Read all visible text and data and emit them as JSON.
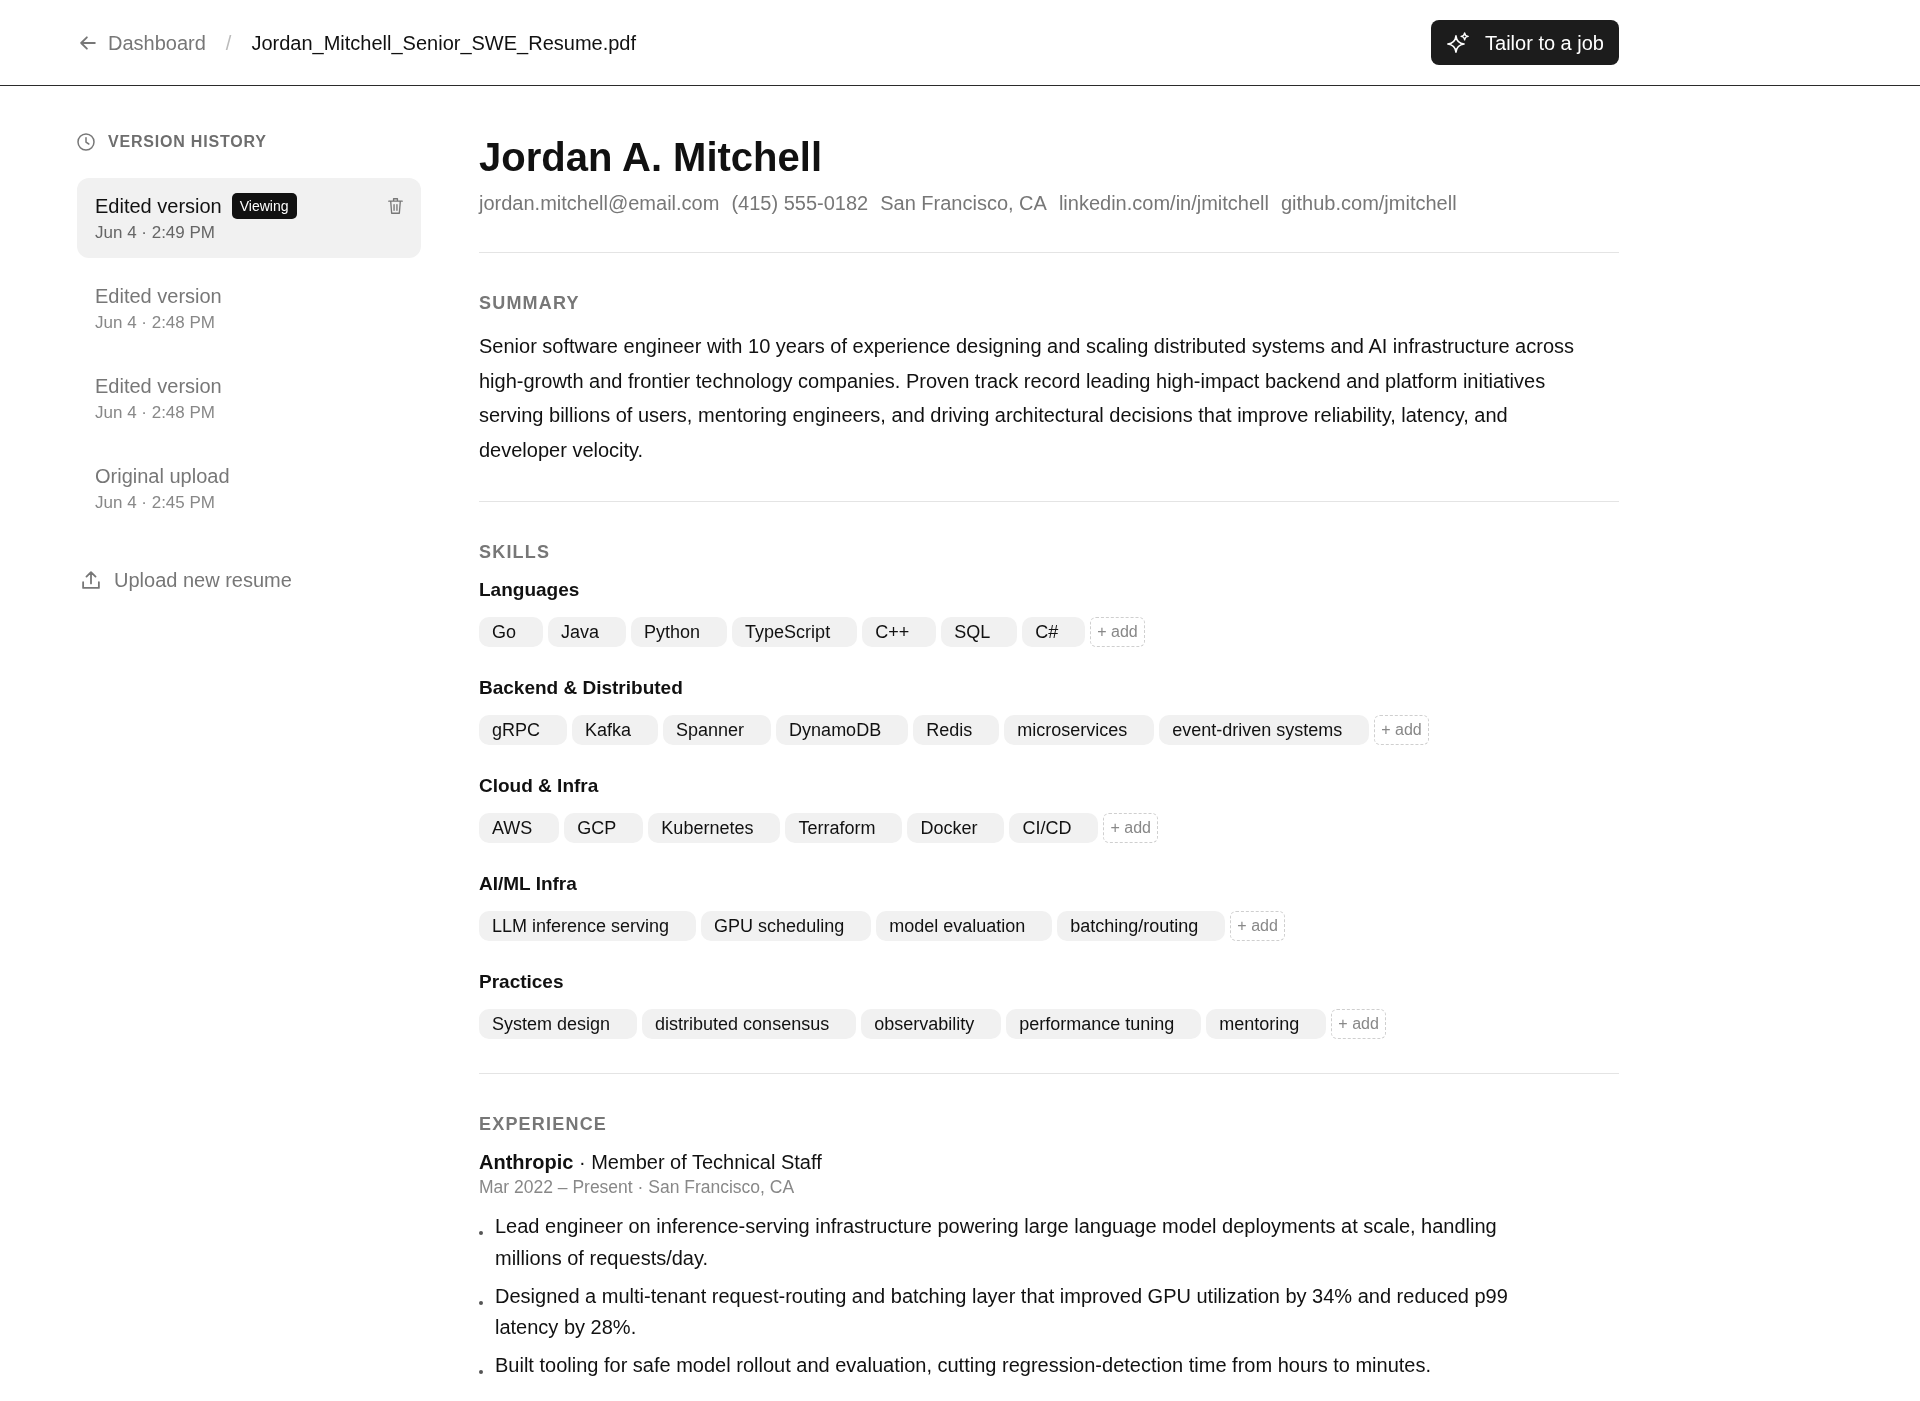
{
  "header": {
    "back_link": "Dashboard",
    "separator": "/",
    "file_name": "Jordan_Mitchell_Senior_SWE_Resume.pdf",
    "action_button": "Tailor to a job"
  },
  "version_history": {
    "title": "VERSION HISTORY",
    "versions": [
      {
        "label": "Edited version",
        "badge": "Viewing",
        "time": "Jun 4 · 2:49 PM",
        "selected": true
      },
      {
        "label": "Edited version",
        "time": "Jun 4 · 2:48 PM",
        "selected": false
      },
      {
        "label": "Edited version",
        "time": "Jun 4 · 2:48 PM",
        "selected": false
      },
      {
        "label": "Original upload",
        "time": "Jun 4 · 2:45 PM",
        "selected": false
      }
    ],
    "upload_link": "Upload new resume"
  },
  "resume": {
    "name": "Jordan A. Mitchell",
    "contact": [
      "jordan.mitchell@email.com",
      "(415) 555-0182",
      "San Francisco, CA",
      "linkedin.com/in/jmitchell",
      "github.com/jmitchell"
    ],
    "sections": [
      {
        "kind": "text",
        "title": "SUMMARY",
        "text": "Senior software engineer with 10 years of experience designing and scaling distributed systems and AI infrastructure across high-growth and frontier technology companies. Proven track record leading high-impact backend and platform initiatives serving billions of users, mentoring engineers, and driving architectural decisions that improve reliability, latency, and developer velocity."
      },
      {
        "kind": "skills",
        "title": "SKILLS",
        "groups": [
          {
            "name": "Languages",
            "skills": [
              "Go",
              "Java",
              "Python",
              "TypeScript",
              "C++",
              "SQL",
              "C#"
            ],
            "add_label": "+ add"
          },
          {
            "name": "Backend & Distributed",
            "skills": [
              "gRPC",
              "Kafka",
              "Spanner",
              "DynamoDB",
              "Redis",
              "microservices",
              "event-driven systems"
            ],
            "add_label": "+ add"
          },
          {
            "name": "Cloud & Infra",
            "skills": [
              "AWS",
              "GCP",
              "Kubernetes",
              "Terraform",
              "Docker",
              "CI/CD"
            ],
            "add_label": "+ add"
          },
          {
            "name": "AI/ML Infra",
            "skills": [
              "LLM inference serving",
              "GPU scheduling",
              "model evaluation",
              "batching/routing"
            ],
            "add_label": "+ add"
          },
          {
            "name": "Practices",
            "skills": [
              "System design",
              "distributed consensus",
              "observability",
              "performance tuning",
              "mentoring"
            ],
            "add_label": "+ add"
          }
        ]
      },
      {
        "kind": "experience",
        "title": "EXPERIENCE",
        "jobs": [
          {
            "title": "**Anthropic** · Member of Technical Staff",
            "meta": "Mar 2022 – Present · San Francisco, CA",
            "bullets": [
              "Lead engineer on inference-serving infrastructure powering large language model deployments at scale, handling millions of requests/day.",
              "Designed a multi-tenant request-routing and batching layer that improved GPU utilization by 34% and reduced p99 latency by 28%.",
              "Built tooling for safe model rollout and evaluation, cutting regression-detection time from hours to minutes."
            ]
          }
        ]
      }
    ]
  }
}
